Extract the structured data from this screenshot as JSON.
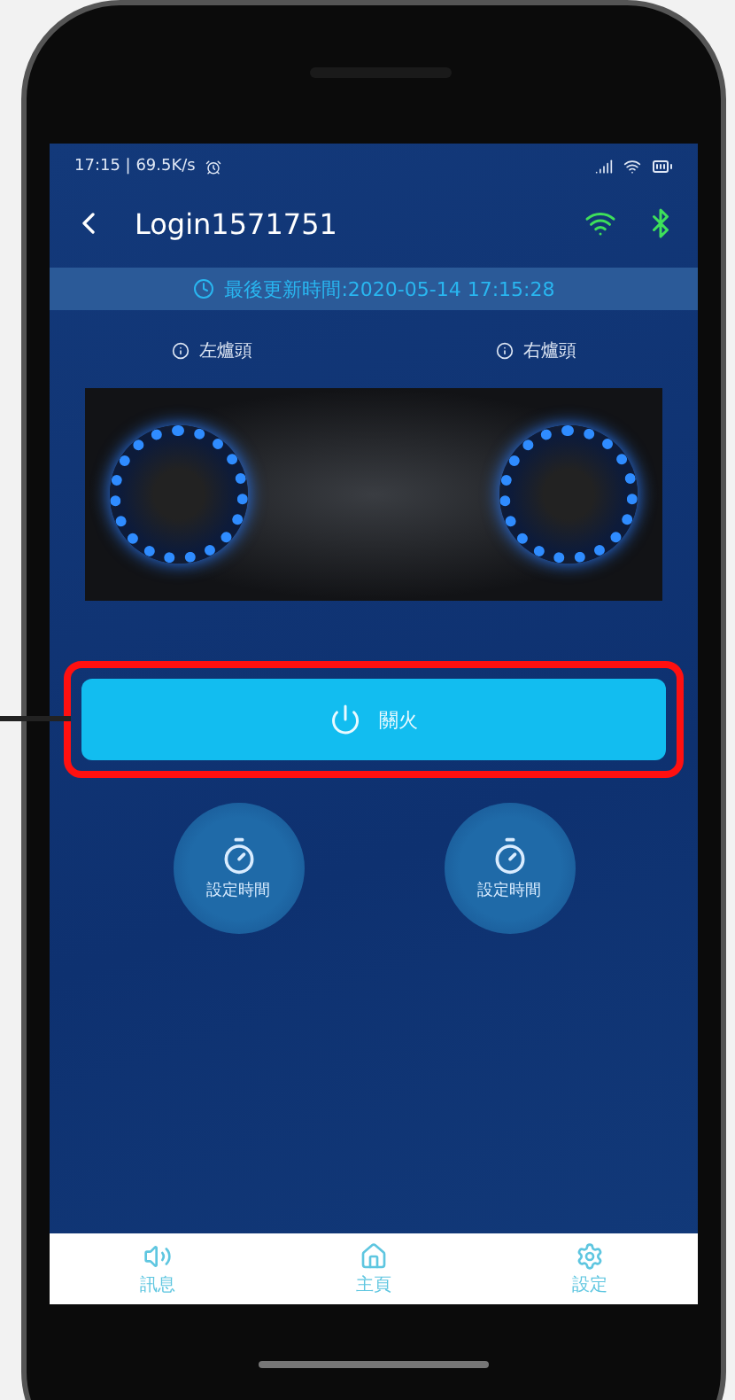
{
  "status_bar": {
    "time_speed": "17:15 | 69.5K/s"
  },
  "header": {
    "title": "Login1571751"
  },
  "update_bar": {
    "text": "最後更新時間:2020-05-14 17:15:28"
  },
  "burners": [
    {
      "label": "左爐頭"
    },
    {
      "label": "右爐頭"
    }
  ],
  "power_button": {
    "label": "關火",
    "annotated": true
  },
  "timers": [
    {
      "label": "設定時間"
    },
    {
      "label": "設定時間"
    }
  ],
  "bottom_nav": [
    {
      "kind": "message",
      "label": "訊息"
    },
    {
      "kind": "home",
      "label": "主頁"
    },
    {
      "kind": "settings",
      "label": "設定"
    }
  ]
}
